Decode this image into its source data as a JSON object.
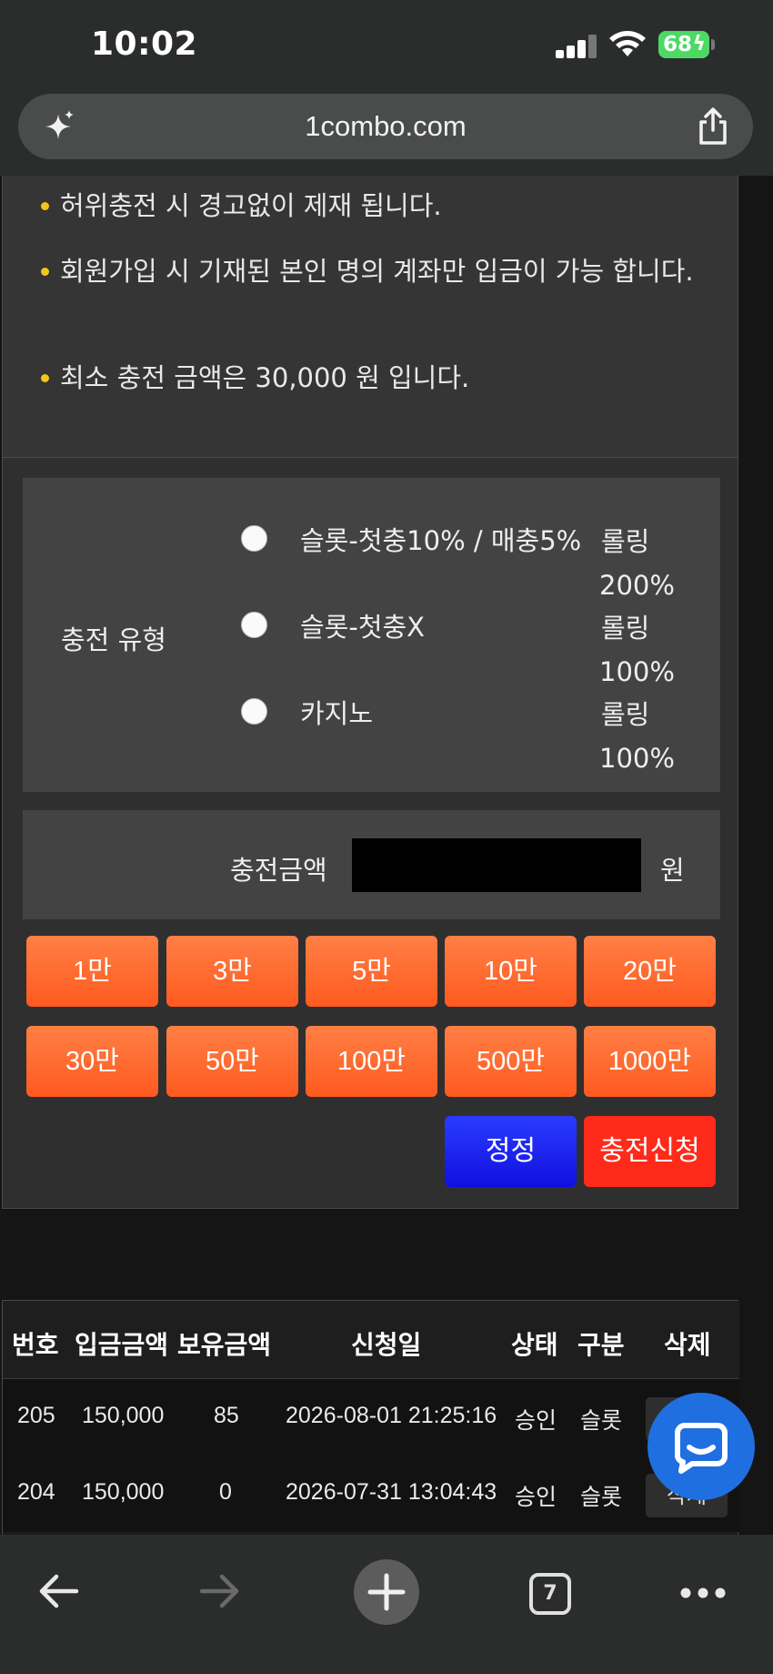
{
  "status_bar": {
    "time": "10:02",
    "battery": "68"
  },
  "browser": {
    "url": "1combo.com",
    "open_tabs": "7"
  },
  "notices": [
    "허위충전 시 경고없이 제재 됩니다.",
    "회원가입 시 기재된 본인 명의 계좌만 입금이 가능 합니다.",
    "최소 충전 금액은 30,000 원 입니다."
  ],
  "charge_type": {
    "label": "충전 유형",
    "options": [
      {
        "name": "슬롯-첫충10% / 매충5%",
        "rolling_label": "롤링",
        "rolling_value": "200%"
      },
      {
        "name": "슬롯-첫충X",
        "rolling_label": "롤링",
        "rolling_value": "100%"
      },
      {
        "name": "카지노",
        "rolling_label": "롤링",
        "rolling_value": "100%"
      }
    ]
  },
  "amount": {
    "label": "충전금액",
    "value": "",
    "unit": "원"
  },
  "quick_amounts": [
    "1만",
    "3만",
    "5만",
    "10만",
    "20만",
    "30만",
    "50만",
    "100만",
    "500만",
    "1000만"
  ],
  "actions": {
    "reset": "정정",
    "apply": "충전신청"
  },
  "history": {
    "headers": [
      "번호",
      "입금금액",
      "보유금액",
      "신청일",
      "상태",
      "구분",
      "삭제"
    ],
    "rows": [
      {
        "no": "205",
        "deposit": "150,000",
        "balance": "85",
        "date": "2026-08-01 21:25:16",
        "status": "승인",
        "type": "슬롯",
        "delete": "삭제"
      },
      {
        "no": "204",
        "deposit": "150,000",
        "balance": "0",
        "date": "2026-07-31 13:04:43",
        "status": "승인",
        "type": "슬롯",
        "delete": "삭제"
      }
    ]
  },
  "colors": {
    "chip_orange": "#ff6a2f",
    "reset_blue": "#1a1aee",
    "apply_red": "#ff2a1a",
    "bullet_yellow": "#f5c518",
    "chat_blue": "#1f6fe0",
    "battery_green": "#4cd964"
  }
}
